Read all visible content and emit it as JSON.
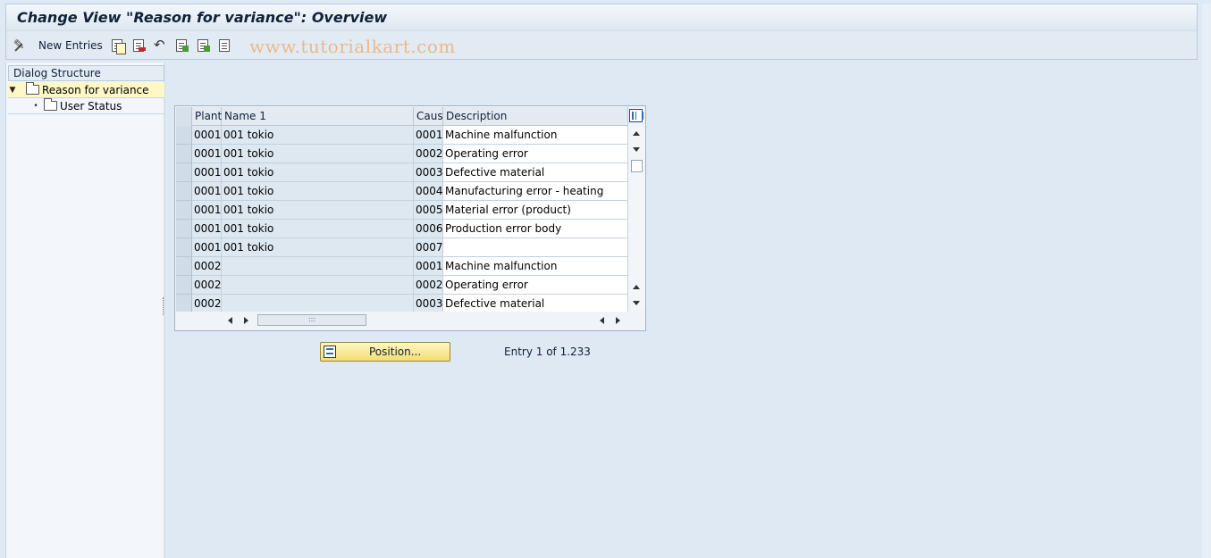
{
  "window": {
    "title": "Change View \"Reason for variance\": Overview"
  },
  "toolbar": {
    "new_entries_label": "New Entries",
    "watermark": "www.tutorialkart.com",
    "icons": [
      "new-entries-icon",
      "copy-icon",
      "delete-icon",
      "undo-icon",
      "select-all-icon",
      "select-block-icon",
      "deselect-all-icon"
    ]
  },
  "dialog_structure": {
    "header": "Dialog Structure",
    "items": [
      {
        "label": "Reason for variance",
        "selected": true,
        "expanded": true
      },
      {
        "label": "User Status",
        "selected": false
      }
    ]
  },
  "table": {
    "columns": [
      "Plant",
      "Name 1",
      "Caus",
      "Description"
    ],
    "rows": [
      {
        "plant": "0001",
        "name": "001 tokio",
        "cause": "0001",
        "description": "Machine malfunction"
      },
      {
        "plant": "0001",
        "name": "001 tokio",
        "cause": "0002",
        "description": "Operating error"
      },
      {
        "plant": "0001",
        "name": "001 tokio",
        "cause": "0003",
        "description": "Defective material"
      },
      {
        "plant": "0001",
        "name": "001 tokio",
        "cause": "0004",
        "description": "Manufacturing error - heating"
      },
      {
        "plant": "0001",
        "name": "001 tokio",
        "cause": "0005",
        "description": "Material error (product)"
      },
      {
        "plant": "0001",
        "name": "001 tokio",
        "cause": "0006",
        "description": "Production error body"
      },
      {
        "plant": "0001",
        "name": "001 tokio",
        "cause": "0007",
        "description": ""
      },
      {
        "plant": "0002",
        "name": "",
        "cause": "0001",
        "description": "Machine malfunction"
      },
      {
        "plant": "0002",
        "name": "",
        "cause": "0002",
        "description": "Operating error"
      },
      {
        "plant": "0002",
        "name": "",
        "cause": "0003",
        "description": "Defective material"
      }
    ]
  },
  "footer": {
    "position_button_label": "Position...",
    "entry_text": "Entry 1 of 1.233"
  }
}
